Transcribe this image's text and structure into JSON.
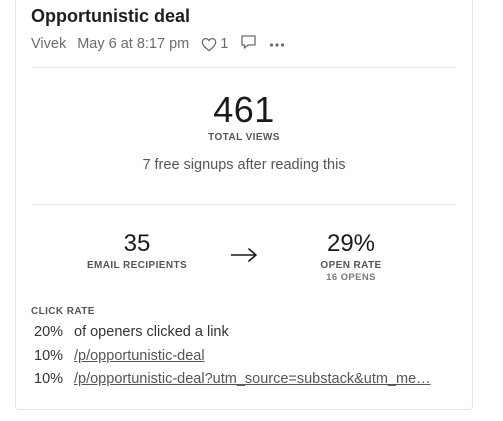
{
  "post": {
    "title": "Opportunistic deal",
    "author": "Vivek",
    "date": "May 6 at 8:17 pm",
    "like_count": "1",
    "icons": [
      "heart-icon",
      "comment-icon",
      "more-icon"
    ]
  },
  "views": {
    "value": "461",
    "label": "TOTAL VIEWS",
    "signups_text": "7 free signups after reading this"
  },
  "email": {
    "recipients_value": "35",
    "recipients_label": "EMAIL RECIPIENTS",
    "arrow": "→",
    "open_rate_value": "29%",
    "open_rate_label": "OPEN RATE",
    "opens_label": "16 OPENS"
  },
  "clicks": {
    "title": "CLICK RATE",
    "rows": [
      {
        "pct": "20%",
        "text": "of openers clicked a link",
        "link": false
      },
      {
        "pct": "10%",
        "text": "/p/opportunistic-deal",
        "link": true
      },
      {
        "pct": "10%",
        "text": "/p/opportunistic-deal?utm_source=substack&utm_me…",
        "link": true
      }
    ]
  },
  "colors": {
    "text": "#1f1f1f",
    "muted": "#6b6b6b",
    "border": "#e6e6e6"
  }
}
